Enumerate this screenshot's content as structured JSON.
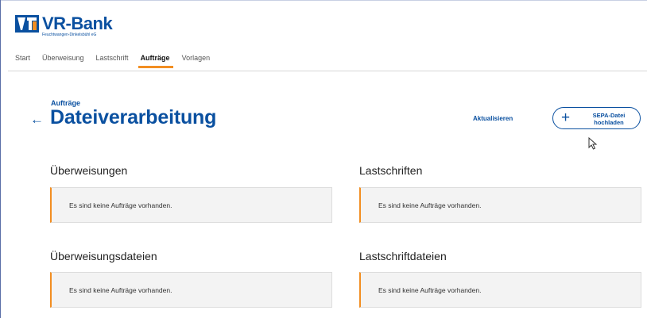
{
  "brand": {
    "name": "VR-Bank",
    "subtitle": "Feuchtwangen-Dinkelsbühl eG",
    "color": "#0a50a0",
    "accent": "#f28e22"
  },
  "nav": {
    "items": [
      {
        "label": "Start",
        "active": false
      },
      {
        "label": "Überweisung",
        "active": false
      },
      {
        "label": "Lastschrift",
        "active": false
      },
      {
        "label": "Aufträge",
        "active": true
      },
      {
        "label": "Vorlagen",
        "active": false
      }
    ]
  },
  "header": {
    "breadcrumb": "Aufträge",
    "title": "Dateiverarbeitung",
    "back_icon": "arrow-left-icon",
    "refresh_label": "Aktualisieren",
    "upload_label_line1": "SEPA-Datei",
    "upload_label_line2": "hochladen"
  },
  "sections": [
    {
      "title": "Überweisungen",
      "message": "Es sind keine Aufträge vorhanden."
    },
    {
      "title": "Lastschriften",
      "message": "Es sind keine Aufträge vorhanden."
    },
    {
      "title": "Überweisungsdateien",
      "message": "Es sind keine Aufträge vorhanden."
    },
    {
      "title": "Lastschriftdateien",
      "message": "Es sind keine Aufträge vorhanden."
    }
  ]
}
